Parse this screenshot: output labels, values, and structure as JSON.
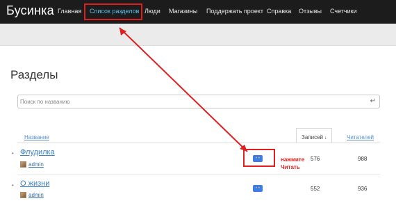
{
  "navbar": {
    "brand": "Бусинка",
    "items": [
      {
        "label": "Главная",
        "active": false
      },
      {
        "label": "Список разделов",
        "active": true
      },
      {
        "label": "Люди",
        "active": false
      },
      {
        "label": "Магазины",
        "active": false
      },
      {
        "label": "Поддержать проект",
        "active": false
      },
      {
        "label": "Справка",
        "active": false
      },
      {
        "label": "Отзывы",
        "active": false
      },
      {
        "label": "Счетчики",
        "active": false
      }
    ]
  },
  "page": {
    "title": "Разделы"
  },
  "search": {
    "placeholder": "Поиск по названию",
    "enter_icon": "enter-icon"
  },
  "table": {
    "columns": {
      "name": "Название",
      "posts": "Записей",
      "posts_sort": "↓",
      "readers": "Читателей"
    },
    "rows": [
      {
        "title": "Флудилка",
        "author": "admin",
        "read_icon": "glasses-icon",
        "posts": "576",
        "readers": "988"
      },
      {
        "title": "О жизни",
        "author": "admin",
        "read_icon": "glasses-icon",
        "posts": "552",
        "readers": "936"
      }
    ]
  },
  "annotation": {
    "hint": "нажмите Читать",
    "color": "#e02020"
  }
}
